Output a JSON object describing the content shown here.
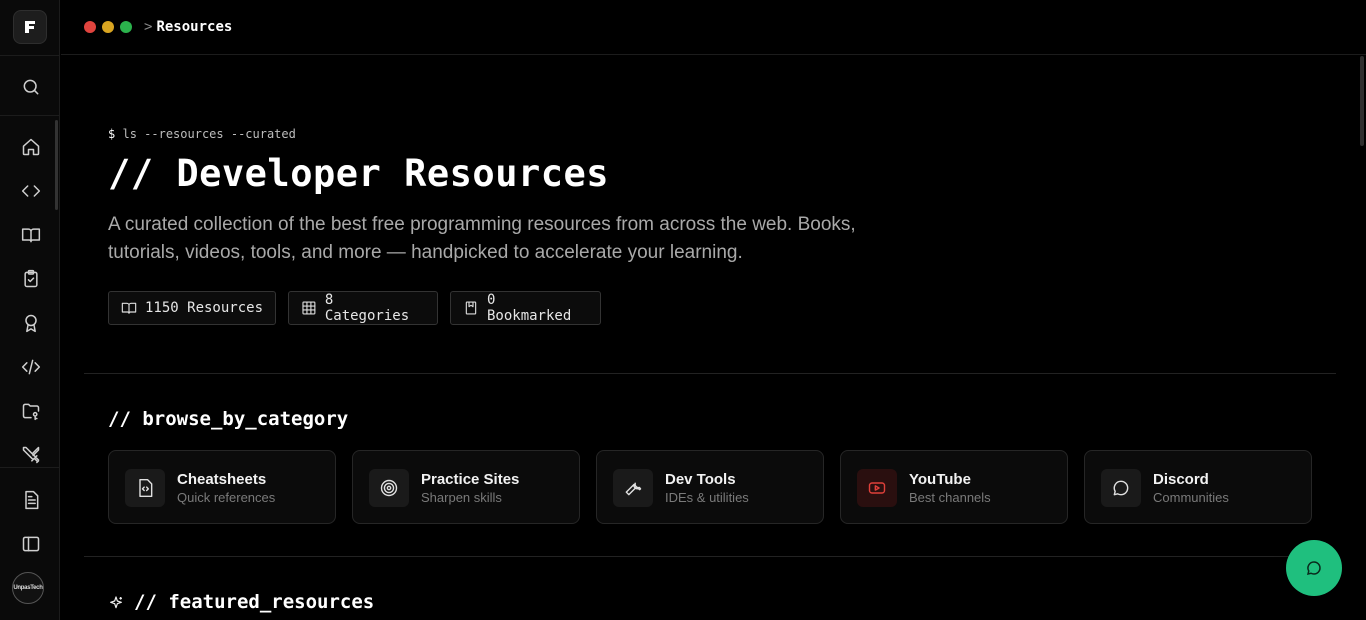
{
  "window": {
    "dot_colors": [
      "#e0443e",
      "#d9a521",
      "#2bb24c"
    ],
    "breadcrumb_sep": ">",
    "breadcrumb": "Resources"
  },
  "sidebar": {
    "logo": "F",
    "items": [
      {
        "icon": "search-icon"
      },
      {
        "icon": "home-icon"
      },
      {
        "icon": "code-brackets-icon"
      },
      {
        "icon": "book-open-icon"
      },
      {
        "icon": "clipboard-check-icon"
      },
      {
        "icon": "award-icon"
      },
      {
        "icon": "code-slash-icon"
      },
      {
        "icon": "folder-key-icon"
      },
      {
        "icon": "swords-icon"
      },
      {
        "icon": "document-icon"
      },
      {
        "icon": "panel-icon"
      }
    ],
    "avatar_text": "UnpasTech"
  },
  "hero": {
    "prompt": "$",
    "command": "ls --resources --curated",
    "title": "// Developer Resources",
    "description": "A curated collection of the best free programming resources from across the web. Books, tutorials, videos, tools, and more — handpicked to accelerate your learning.",
    "stats": [
      {
        "icon": "book-open-icon",
        "label": "1150 Resources"
      },
      {
        "icon": "grid-icon",
        "label": "8 Categories"
      },
      {
        "icon": "bookmark-icon",
        "label": "0 Bookmarked"
      }
    ]
  },
  "browse": {
    "title": "// browse_by_category",
    "categories": [
      {
        "icon": "file-code-icon",
        "title": "Cheatsheets",
        "subtitle": "Quick references"
      },
      {
        "icon": "target-icon",
        "title": "Practice Sites",
        "subtitle": "Sharpen skills"
      },
      {
        "icon": "wrench-icon",
        "title": "Dev Tools",
        "subtitle": "IDEs & utilities"
      },
      {
        "icon": "youtube-icon",
        "title": "YouTube",
        "subtitle": "Best channels"
      },
      {
        "icon": "chat-bubble-icon",
        "title": "Discord",
        "subtitle": "Communities"
      }
    ]
  },
  "featured": {
    "title": "// featured_resources"
  },
  "colors": {
    "accent_green": "#1fbf7e",
    "youtube_red": "#e0403a"
  }
}
